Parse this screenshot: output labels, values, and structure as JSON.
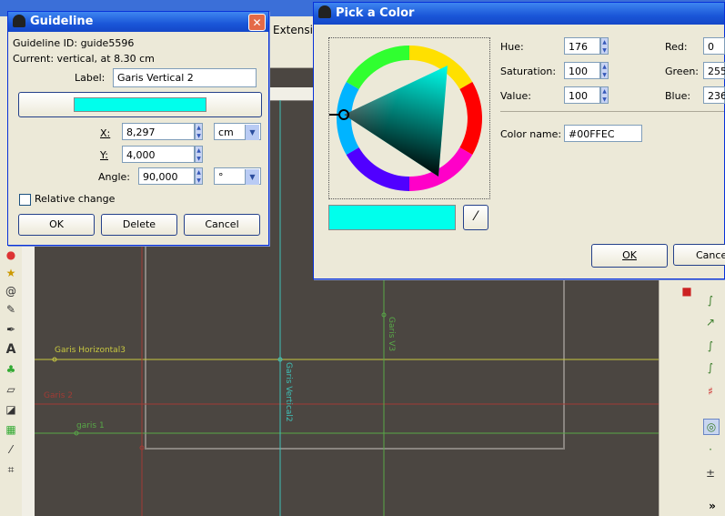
{
  "background": {
    "menu_extensions": "Extensio",
    "canvas_labels": {
      "garis_horizontal3": "Garis Horizontal3",
      "garis2": "Garis 2",
      "garis1": "garis 1",
      "garis_vertical2": "Garis Vertical2",
      "garis_v3": "Garis V3"
    }
  },
  "guideline_dialog": {
    "title": "Guideline",
    "guide_id": "Guideline ID: guide5596",
    "current": "Current: vertical, at 8.30 cm",
    "label_caption": "Label:",
    "label_value": "Garis Vertical 2",
    "swatch_color": "#00ffec",
    "x_caption": "X:",
    "x_value": "8,297",
    "y_caption": "Y:",
    "y_value": "4,000",
    "angle_caption": "Angle:",
    "angle_value": "90,000",
    "unit_value": "cm",
    "angle_unit_value": "°",
    "relative_change": "Relative change",
    "ok": "OK",
    "delete": "Delete",
    "cancel": "Cancel"
  },
  "color_dialog": {
    "title": "Pick a Color",
    "hue_caption": "Hue:",
    "hue_value": "176",
    "saturation_caption": "Saturation:",
    "saturation_value": "100",
    "value_caption": "Value:",
    "value_value": "100",
    "red_caption": "Red:",
    "red_value": "0",
    "green_caption": "Green:",
    "green_value": "255",
    "blue_caption": "Blue:",
    "blue_value": "236",
    "color_name_caption": "Color name:",
    "color_name_value": "#00FFEC",
    "preview_color": "#00ffec",
    "ok": "OK",
    "cancel": "Cancel"
  },
  "colors": {
    "guide_cyan": "#3fc0b8",
    "guide_yellow": "#c8c840",
    "guide_red": "#a03b35",
    "guide_green": "#58a848"
  }
}
